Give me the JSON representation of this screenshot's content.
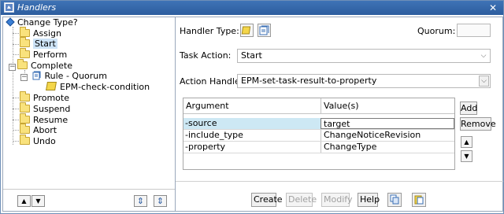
{
  "window": {
    "title": "Handlers"
  },
  "tree": {
    "root": "Change Type?",
    "items": [
      {
        "label": "Assign"
      },
      {
        "label": "Start"
      },
      {
        "label": "Perform"
      },
      {
        "label": "Complete"
      },
      {
        "label": "Rule - Quorum"
      },
      {
        "label": "EPM-check-condition"
      },
      {
        "label": "Promote"
      },
      {
        "label": "Suspend"
      },
      {
        "label": "Resume"
      },
      {
        "label": "Abort"
      },
      {
        "label": "Undo"
      }
    ],
    "toolbar": {
      "up": "▲",
      "down": "▼",
      "expand": "⇕",
      "collapse": "⇕"
    }
  },
  "form": {
    "handler_type_label": "Handler Type:",
    "quorum_label": "Quorum:",
    "quorum_value": "",
    "task_action_label": "Task Action:",
    "task_action_value": "Start",
    "action_handler_label": "Action Handler:",
    "action_handler_value": "EPM-set-task-result-to-property"
  },
  "table": {
    "columns": [
      "Argument",
      "Value(s)"
    ],
    "rows": [
      {
        "argument": "-source",
        "value": "target"
      },
      {
        "argument": "-include_type",
        "value": "ChangeNoticeRevision"
      },
      {
        "argument": "-property",
        "value": "ChangeType"
      }
    ]
  },
  "side_buttons": {
    "add": "Add",
    "remove": "Remove",
    "up": "▲",
    "down": "▼"
  },
  "actions": {
    "create": "Create",
    "delete": "Delete",
    "modify": "Modify",
    "help": "Help"
  },
  "icons": {
    "app": "handlers-app-icon",
    "handler_type_action": "folder-handler-icon",
    "handler_type_rule": "rule-handler-icon",
    "copy": "copy-icon",
    "paste": "paste-icon"
  }
}
